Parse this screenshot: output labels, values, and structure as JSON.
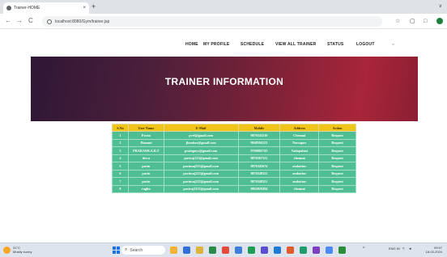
{
  "browser": {
    "tab_title": "Trainer-HOME",
    "tab_close": "×",
    "new_tab": "+",
    "window_controls": "∨",
    "url": "localhost:8080/Gym/trainer.jsp",
    "back_icon": "←",
    "forward_icon": "→",
    "reload_icon": "C",
    "star_icon": "☆",
    "sidepanel_icon": "▢",
    "window_icon": "□"
  },
  "nav": {
    "items": [
      "HOME",
      "MY PROFILE",
      "SCHEDULE",
      "VIEW ALL TRAINER",
      "STATUS",
      "LOGOUT"
    ],
    "cursor_icon": "⇔"
  },
  "hero": {
    "title": "TRAINER INFORMATION"
  },
  "table": {
    "headers": [
      "S.No",
      "User Name",
      "E-Mail",
      "Mobile",
      "Address",
      "Action"
    ],
    "rows": [
      [
        "1",
        "Pavan",
        "pvel@gmail.com",
        "9876543210",
        "Chennai",
        "Request"
      ],
      [
        "2",
        "Jhanani",
        "jhanitar@gmail.com",
        "9948594123",
        "Narsapur",
        "Request"
      ],
      [
        "3",
        "PRAKASH.A.R.T",
        "prainguys@gmail.com",
        "9700002743",
        "Vadapalani",
        "Request"
      ],
      [
        "4",
        "dewa",
        "pavisaj123@gmail.com",
        "9876567321",
        "chennai",
        "Request"
      ],
      [
        "5",
        "pavin",
        "pavinsaj555@gmail.com",
        "9876345674",
        "ambattur",
        "Request"
      ],
      [
        "6",
        "pavin",
        "pavinsaj222@gmail.com",
        "9876548321",
        "ambattur",
        "Request"
      ],
      [
        "7",
        "pavin",
        "pavinsaj222@gmail.com",
        "9876548321",
        "ambattur",
        "Request"
      ],
      [
        "8",
        "raghu",
        "paviraj1122@gmail.com",
        "9894929494",
        "chennai",
        "Request"
      ]
    ]
  },
  "taskbar": {
    "weather_temp": "31°C",
    "weather_desc": "Mostly sunny",
    "search_placeholder": "Search",
    "search_icon": "⌕",
    "tray_text": "ENG IN",
    "time": "09:57",
    "date": "18-03-2024",
    "app_colors": [
      "#f2b233",
      "#2f6fd6",
      "#e0b43a",
      "#2a8a4a",
      "#e34b3b",
      "#3d7fd8",
      "#1f9d55",
      "#5a4fcf",
      "#1f7ad6",
      "#e05a2b",
      "#1d9d6b",
      "#7b3fbf",
      "#4c8bf5",
      "#2b8c3a"
    ]
  },
  "colors": {
    "header_bg": "#f0c419",
    "row_bg": "#4fbf93",
    "hero_dark": "#2e1735",
    "hero_red": "#a8253a"
  }
}
